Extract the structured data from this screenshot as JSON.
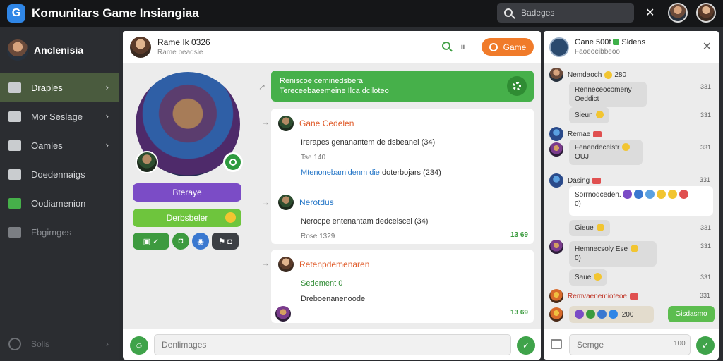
{
  "app": {
    "title": "Komunitars Game Insiangiaa",
    "search_placeholder": "Badeges"
  },
  "sidebar": {
    "user_name": "Anclenisia",
    "items": [
      {
        "label": "Draples",
        "active": true
      },
      {
        "label": "Mor Seslage"
      },
      {
        "label": "Oamles"
      },
      {
        "label": "Doedennaigs"
      },
      {
        "label": "Oodiamenion"
      },
      {
        "label": "Fbgimges"
      }
    ],
    "bottom_label": "Solls"
  },
  "chat": {
    "name": "Rame Ik 0326",
    "subtitle": "Rame beadsie",
    "game_button": "Game",
    "profile": {
      "purple_pill": "Bteraye",
      "green_pill": "Derbsbeler"
    },
    "pinned_message": {
      "line1": "Reniscoe ceminedsbera",
      "line2": "Tereceebaeemeine Ilca dciloteo"
    },
    "messages": [
      {
        "author": "Gane Cedelen",
        "text": "Irerapes genanantem de dsbeanel (34)",
        "small": "Tse 140",
        "blue_part": "Mtenonebamidenm die",
        "rest": "doterbojars (234)"
      },
      {
        "author": "Nerotdus",
        "text": "Nerocpe entenantam dedcelscel (34)",
        "small": "Rose 1329",
        "time": "13 69"
      },
      {
        "author": "Retenpdemenaren",
        "green_line": "Sedement 0",
        "text": "Dreboenanenoode",
        "time": "13 69"
      }
    ],
    "composer_placeholder": "Denlimages"
  },
  "right_panel": {
    "title": "Gane 500f",
    "title_suffix": "Sldens",
    "subtitle": "Faoeoeibbeoo",
    "messages": [
      {
        "name": "Nemdaoch",
        "num": "280",
        "time": "331",
        "bubble": "Renneceocomeny Oeddict",
        "reply": "Sieun",
        "reply_time": "331"
      },
      {
        "name": "Remae",
        "time": "",
        "bubble": "Fenendecelstr",
        "bubble2": "OUJ",
        "bubble_time": "331"
      },
      {
        "name": "Dasing",
        "time": "331",
        "bubble": "Sorrnodceden.",
        "bubble2": "0)",
        "reply": "Gieue",
        "reply_time": "331"
      },
      {
        "name": "Hemnecsoly Ese",
        "bubble2": "0)",
        "reply": "Saue",
        "reply_time": "331",
        "time": "331"
      },
      {
        "name": "Remvaenemioteoe",
        "time": "331",
        "reply_extra": "200",
        "green_bubble": "Gisdasmo"
      }
    ],
    "composer_placeholder": "Semge",
    "composer_count": "100"
  },
  "colors": {
    "accent_green": "#46b04a",
    "accent_orange": "#f07b2a",
    "accent_purple": "#7b4cc6",
    "sidebar_active": "#4a5b3e"
  }
}
